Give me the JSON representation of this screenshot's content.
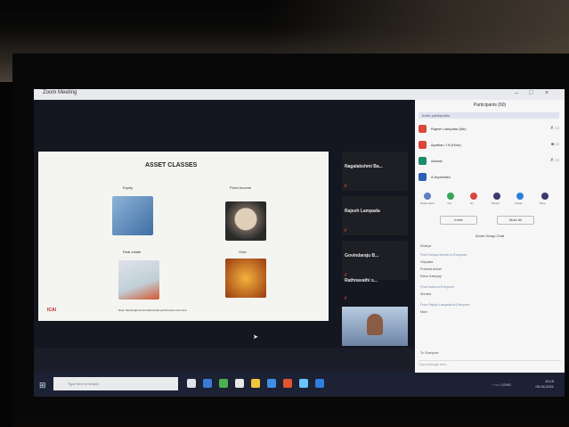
{
  "app": {
    "title": "Zoom Meeting"
  },
  "slide": {
    "title": "ASSET CLASSES",
    "labels": [
      "Equity",
      "Fixed Income",
      "Real estate",
      "Gold"
    ],
    "note": "Note: Meaningful and fundamental performance over time.",
    "logo": "ICAI"
  },
  "tiles": [
    {
      "name": "Nagalakshmi Ba..."
    },
    {
      "name": "Rajesh Lampada"
    },
    {
      "name": "Govindaraju B..."
    },
    {
      "name": "Rathnavathi s..."
    }
  ],
  "participants_panel": {
    "header": "Participants (60)",
    "invite": "Invite participants",
    "rows": [
      {
        "name": "Rajesh Lampada (Me)",
        "color": "#d9483b"
      },
      {
        "name": "Ayathan J N (Host)",
        "color": "#d9483b"
      },
      {
        "name": "Ashwin",
        "color": "#1c8c6e"
      },
      {
        "name": "A Aryabhata",
        "color": "#2d5fb3"
      }
    ],
    "reactions": [
      "Raise Hand",
      "Yes",
      "No",
      "Slower",
      "Faster",
      "More"
    ],
    "reaction_colors": [
      "#5f7fbf",
      "#3aa35a",
      "#d9483b",
      "#3a3a6a",
      "#2d7fd9",
      "#3a3a6a"
    ],
    "buttons": {
      "left": "Invite",
      "right": "Mute All"
    },
    "chat_header": "Zoom Group Chat",
    "chat": [
      "Dhanya",
      "From Ramya Suresh to Everyone:",
      "Vidyalata",
      "Prashad Ashah",
      "Rahul Kashyap",
      "From Indira to Everyone:",
      "Shrutha",
      "From Rajesh Lampada to Everyone:",
      "Mani"
    ],
    "chat_to": "To:  Everyone",
    "chat_placeholder": "Type message here..."
  },
  "taskbar": {
    "search_placeholder": "Type here to search",
    "icon_colors": [
      "#dfe3ea",
      "#3a7bd5",
      "#4caf50",
      "#e8e8e8",
      "#f2c33c",
      "#3f8ee8",
      "#e0552f",
      "#6cc1ff",
      "#2f7de1"
    ],
    "time": "10:15",
    "date": "09-04-2021"
  }
}
